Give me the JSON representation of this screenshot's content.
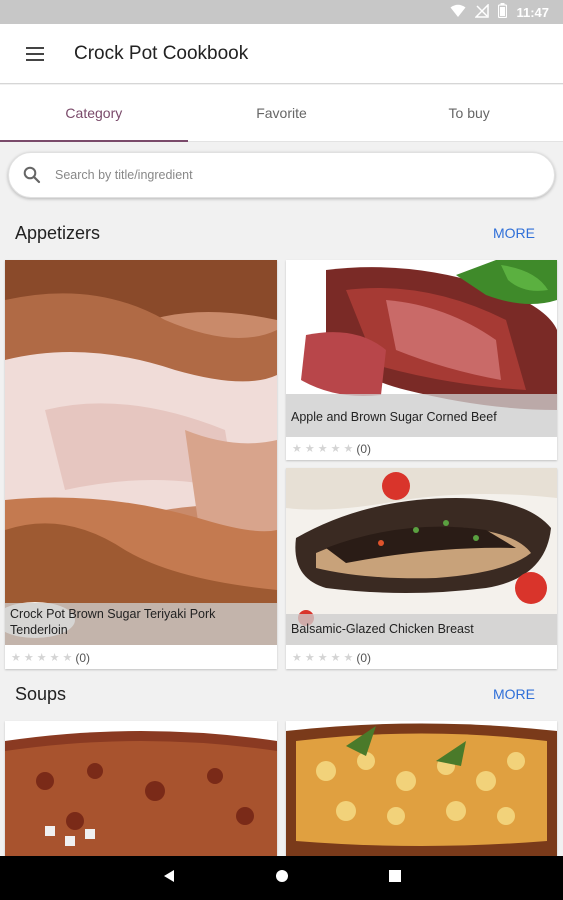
{
  "status_bar": {
    "time": "11:47"
  },
  "app_bar": {
    "title": "Crock Pot Cookbook"
  },
  "tabs": [
    {
      "label": "Category",
      "active": true
    },
    {
      "label": "Favorite",
      "active": false
    },
    {
      "label": "To buy",
      "active": false
    }
  ],
  "search": {
    "placeholder": "Search by title/ingredient"
  },
  "sections": [
    {
      "title": "Appetizers",
      "more": "MORE",
      "recipes": [
        {
          "title": "Crock Pot Brown Sugar Teriyaki Pork Tenderloin",
          "rating": 0,
          "count": "(0)"
        },
        {
          "title": "Apple and Brown Sugar Corned Beef",
          "rating": 0,
          "count": "(0)"
        },
        {
          "title": "Balsamic-Glazed Chicken Breast",
          "rating": 0,
          "count": "(0)"
        }
      ]
    },
    {
      "title": "Soups",
      "more": "MORE",
      "recipes": []
    }
  ],
  "colors": {
    "accent": "#7a4a6a",
    "link": "#2f6fd8"
  }
}
